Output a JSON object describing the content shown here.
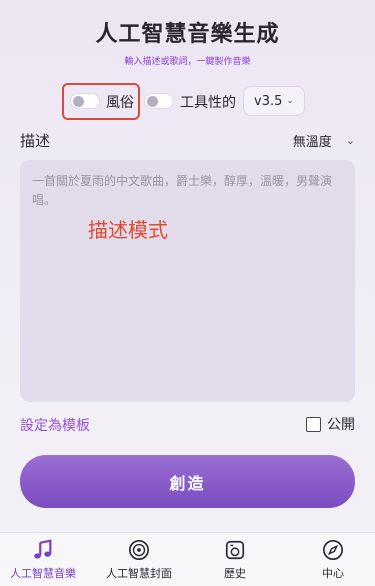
{
  "header": {
    "title": "人工智慧音樂生成",
    "subtitle": "輸入描述或歌詞，一鍵製作音樂"
  },
  "controls": {
    "toggle_style_label": "風俗",
    "toggle_instrumental_label": "工具性的",
    "version_value": "v3.5"
  },
  "description": {
    "label": "描述",
    "mood_value": "無溫度",
    "placeholder": "一首關於夏雨的中文歌曲，爵士樂，醇厚，溫暖，男聲演唱。",
    "overlay_label": "描述模式"
  },
  "template": {
    "link": "設定為模板",
    "public_label": "公開"
  },
  "create_button": "創造",
  "nav": [
    {
      "label": "人工智慧音樂",
      "icon": "music-note-icon",
      "active": true
    },
    {
      "label": "人工智慧封面",
      "icon": "disc-icon",
      "active": false
    },
    {
      "label": "歷史",
      "icon": "history-icon",
      "active": false
    },
    {
      "label": "中心",
      "icon": "compass-icon",
      "active": false
    }
  ],
  "colors": {
    "accent": "#7a3fc4",
    "highlight_box": "#d64b3b",
    "overlay_text": "#e24a2f"
  }
}
